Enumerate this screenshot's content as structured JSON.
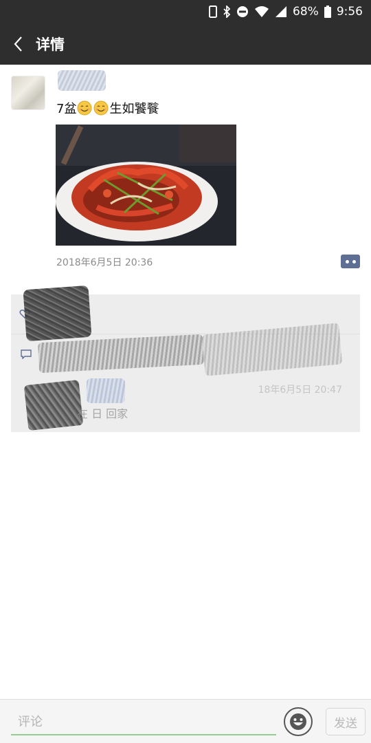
{
  "status_bar": {
    "battery": "68%",
    "time": "9:56",
    "icons": [
      "phone-icon",
      "bluetooth-icon",
      "dnd-icon",
      "wifi-icon",
      "signal-icon",
      "battery-icon"
    ]
  },
  "header": {
    "back_icon": "chevron-left-icon",
    "title": "详情"
  },
  "post": {
    "text_before": "7盆",
    "emojis": [
      "smile-emoji",
      "smile-emoji"
    ],
    "text_after": "生如饕餮",
    "timestamp": "2018年6月5日 20:36",
    "photo_subject": "crayfish-dish-photo"
  },
  "interactions": {
    "comment": {
      "time": "18年6月5日 20:47",
      "text": "在    日        回家"
    }
  },
  "composer": {
    "placeholder": "评论",
    "send_label": "发送"
  },
  "colors": {
    "header_bg": "#2e2e2e",
    "comment_button": "#5f6f93",
    "input_underline": "#8fce8f"
  }
}
